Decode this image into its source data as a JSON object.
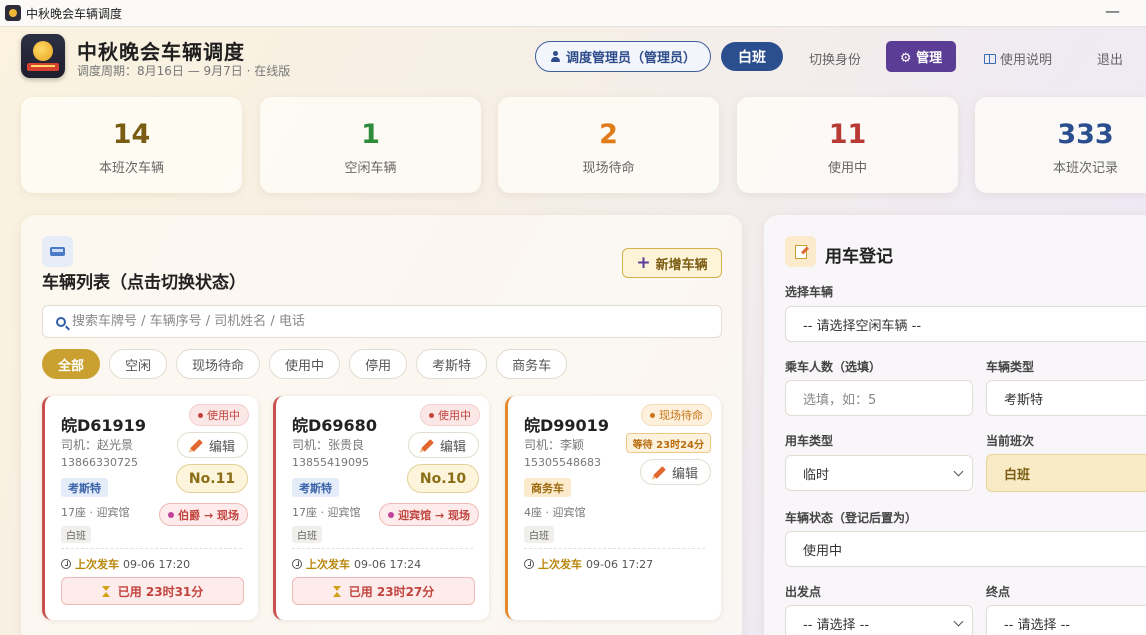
{
  "window": {
    "title": "中秋晚会车辆调度",
    "minimize": "—"
  },
  "header": {
    "title": "中秋晚会车辆调度",
    "subtitle": "调度周期：8月16日 — 9月7日 · 在线版",
    "role": "调度管理员（管理员）",
    "shift": "白班",
    "switch_identity": "切换身份",
    "manage": "⚙ 管理",
    "help": "使用说明",
    "logout": "退出"
  },
  "colors": {
    "brand_gold": "#caa131",
    "brand_navy": "#2b4f8e",
    "manage_purple": "#5c3d95",
    "in_use_red": "#c2443f",
    "waiting_orange": "#c77517"
  },
  "stats": [
    {
      "value": "14",
      "label": "本班次车辆",
      "color": "#7a5d13"
    },
    {
      "value": "1",
      "label": "空闲车辆",
      "color": "#2e8b3a"
    },
    {
      "value": "2",
      "label": "现场待命",
      "color": "#e07b1a"
    },
    {
      "value": "11",
      "label": "使用中",
      "color": "#b83a35"
    },
    {
      "value": "333",
      "label": "本班次记录",
      "color": "#2b4f8e"
    }
  ],
  "vehicle_list": {
    "title": "车辆列表（点击切换状态）",
    "add_button": "新增车辆",
    "search_placeholder": "搜索车牌号 / 车辆序号 / 司机姓名 / 电话",
    "filters": [
      "全部",
      "空闲",
      "现场待命",
      "使用中",
      "停用",
      "考斯特",
      "商务车"
    ],
    "cards": [
      {
        "plate": "皖D61919",
        "status": "使用中",
        "driver": "司机：赵光景",
        "phone": "13866330725",
        "type": "考斯特",
        "edit": "编辑",
        "number": "No.11",
        "seats": "17座 · 迎宾馆",
        "route": "伯爵 → 现场",
        "shift": "白班",
        "last_label": "上次发车",
        "last_time": "09-06 17:20",
        "used": "已用 23时31分"
      },
      {
        "plate": "皖D69680",
        "status": "使用中",
        "driver": "司机：张贵良",
        "phone": "13855419095",
        "type": "考斯特",
        "edit": "编辑",
        "number": "No.10",
        "seats": "17座 · 迎宾馆",
        "route": "迎宾馆 → 现场",
        "shift": "白班",
        "last_label": "上次发车",
        "last_time": "09-06 17:24",
        "used": "已用 23时27分"
      },
      {
        "plate": "皖D99019",
        "status": "现场待命",
        "driver": "司机：李颖",
        "phone": "15305548683",
        "type": "商务车",
        "edit": "编辑",
        "wait": "等待 23时24分",
        "seats": "4座 · 迎宾馆",
        "shift": "白班",
        "last_label": "上次发车",
        "last_time": "09-06 17:27"
      }
    ]
  },
  "registration": {
    "title": "用车登记",
    "select_vehicle_label": "选择车辆",
    "select_vehicle_value": "-- 请选择空闲车辆 --",
    "passengers_label": "乘车人数（选填）",
    "passengers_placeholder": "选填，如：5",
    "vehicle_type_label": "车辆类型",
    "vehicle_type_value": "考斯特",
    "use_type_label": "用车类型",
    "use_type_value": "临时",
    "current_shift_label": "当前班次",
    "current_shift_value": "白班",
    "status_label": "车辆状态（登记后置为）",
    "status_value": "使用中",
    "origin_label": "出发点",
    "origin_value": "-- 请选择 --",
    "destination_label": "终点",
    "destination_value": "-- 请选择 --"
  }
}
